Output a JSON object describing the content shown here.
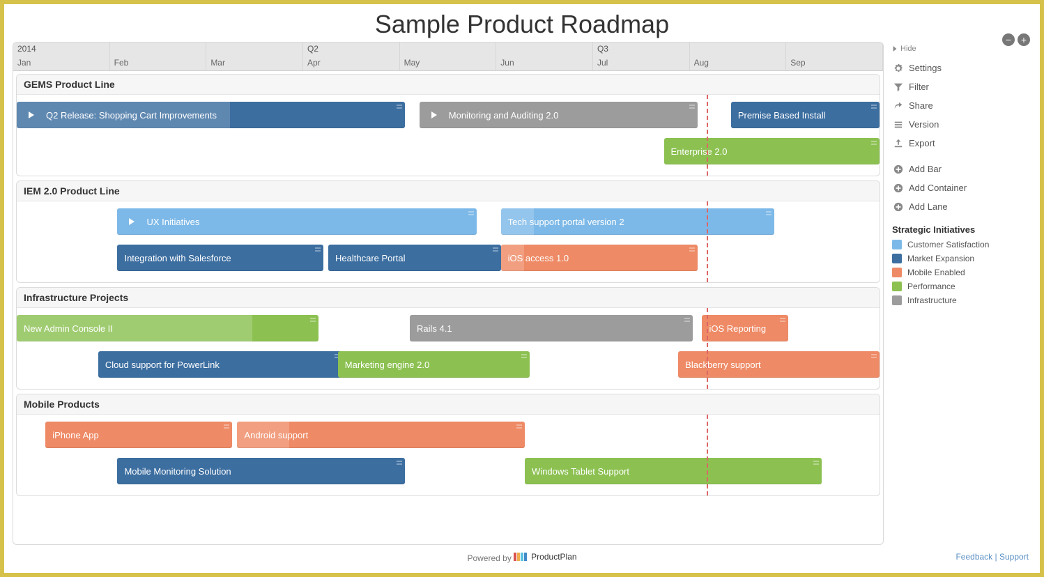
{
  "title": "Sample Product Roadmap",
  "timeline": {
    "year": "2014",
    "quarters": [
      "",
      "Q2",
      "Q3",
      ""
    ],
    "months": [
      "Jan",
      "Feb",
      "Mar",
      "Apr",
      "May",
      "Jun",
      "Jul",
      "Aug",
      "Sep"
    ],
    "total_months": 9,
    "today_month_index": 7.2
  },
  "colors": {
    "customer": "#7db9e8",
    "market": "#3c6ea0",
    "mobile": "#ee8a65",
    "performance": "#8cc152",
    "infrastructure": "#9c9c9c"
  },
  "lanes": [
    {
      "title": "GEMS Product Line",
      "tracks": [
        [
          {
            "label": "Q2 Release: Shopping Cart Improvements",
            "start": 0.0,
            "span": 4.05,
            "color": "market",
            "expandable": true,
            "progress": 55
          },
          {
            "label": "Monitoring and Auditing 2.0",
            "start": 4.2,
            "span": 2.9,
            "color": "infrastructure",
            "expandable": true
          },
          {
            "label": "Premise Based Install",
            "start": 7.45,
            "span": 1.55,
            "color": "market"
          }
        ],
        [
          {
            "label": "Enterprise 2.0",
            "start": 6.75,
            "span": 2.25,
            "color": "performance"
          }
        ]
      ]
    },
    {
      "title": "IEM 2.0 Product Line",
      "tracks": [
        [
          {
            "label": "UX Initiatives",
            "start": 1.05,
            "span": 3.75,
            "color": "customer",
            "expandable": true
          },
          {
            "label": "Tech support portal version 2",
            "start": 5.05,
            "span": 2.85,
            "color": "customer",
            "progress": 12
          }
        ],
        [
          {
            "label": "Integration with Salesforce",
            "start": 1.05,
            "span": 2.15,
            "color": "market"
          },
          {
            "label": "Healthcare Portal",
            "start": 3.25,
            "span": 1.8,
            "color": "market"
          },
          {
            "label": "iOS access 1.0",
            "start": 5.05,
            "span": 2.05,
            "color": "mobile",
            "progress": 12
          }
        ]
      ]
    },
    {
      "title": "Infrastructure Projects",
      "tracks": [
        [
          {
            "label": "New Admin Console II",
            "start": 0.0,
            "span": 3.15,
            "color": "performance",
            "progress": 78
          },
          {
            "label": "Rails 4.1",
            "start": 4.1,
            "span": 2.95,
            "color": "infrastructure"
          },
          {
            "label": "iOS Reporting",
            "start": 7.15,
            "span": 0.9,
            "color": "mobile"
          }
        ],
        [
          {
            "label": "Cloud support for PowerLink",
            "start": 0.85,
            "span": 2.55,
            "color": "market"
          },
          {
            "label": "Marketing engine 2.0",
            "start": 3.35,
            "span": 2.0,
            "color": "performance"
          },
          {
            "label": "Blackberry support",
            "start": 6.9,
            "span": 2.1,
            "color": "mobile"
          }
        ]
      ]
    },
    {
      "title": "Mobile Products",
      "tracks": [
        [
          {
            "label": "iPhone App",
            "start": 0.3,
            "span": 1.95,
            "color": "mobile"
          },
          {
            "label": "Android support",
            "start": 2.3,
            "span": 3.0,
            "color": "mobile",
            "progress": 18
          }
        ],
        [
          {
            "label": "Mobile Monitoring Solution",
            "start": 1.05,
            "span": 3.0,
            "color": "market"
          },
          {
            "label": "Windows Tablet Support",
            "start": 5.3,
            "span": 3.1,
            "color": "performance"
          }
        ]
      ]
    }
  ],
  "sidebar": {
    "hide": "Hide",
    "items": [
      {
        "icon": "gear",
        "label": "Settings"
      },
      {
        "icon": "filter",
        "label": "Filter"
      },
      {
        "icon": "share",
        "label": "Share"
      },
      {
        "icon": "version",
        "label": "Version"
      },
      {
        "icon": "export",
        "label": "Export"
      }
    ],
    "add_items": [
      {
        "icon": "plus",
        "label": "Add Bar"
      },
      {
        "icon": "plus",
        "label": "Add Container"
      },
      {
        "icon": "plus",
        "label": "Add Lane"
      }
    ],
    "legend_title": "Strategic Initiatives",
    "legend": [
      {
        "color": "customer",
        "label": "Customer Satisfaction"
      },
      {
        "color": "market",
        "label": "Market Expansion"
      },
      {
        "color": "mobile",
        "label": "Mobile Enabled"
      },
      {
        "color": "performance",
        "label": "Performance"
      },
      {
        "color": "infrastructure",
        "label": "Infrastructure"
      }
    ]
  },
  "footer": {
    "powered": "Powered by",
    "brand": "ProductPlan",
    "feedback": "Feedback",
    "support": "Support"
  },
  "zoom": {
    "out": "−",
    "in": "+"
  }
}
